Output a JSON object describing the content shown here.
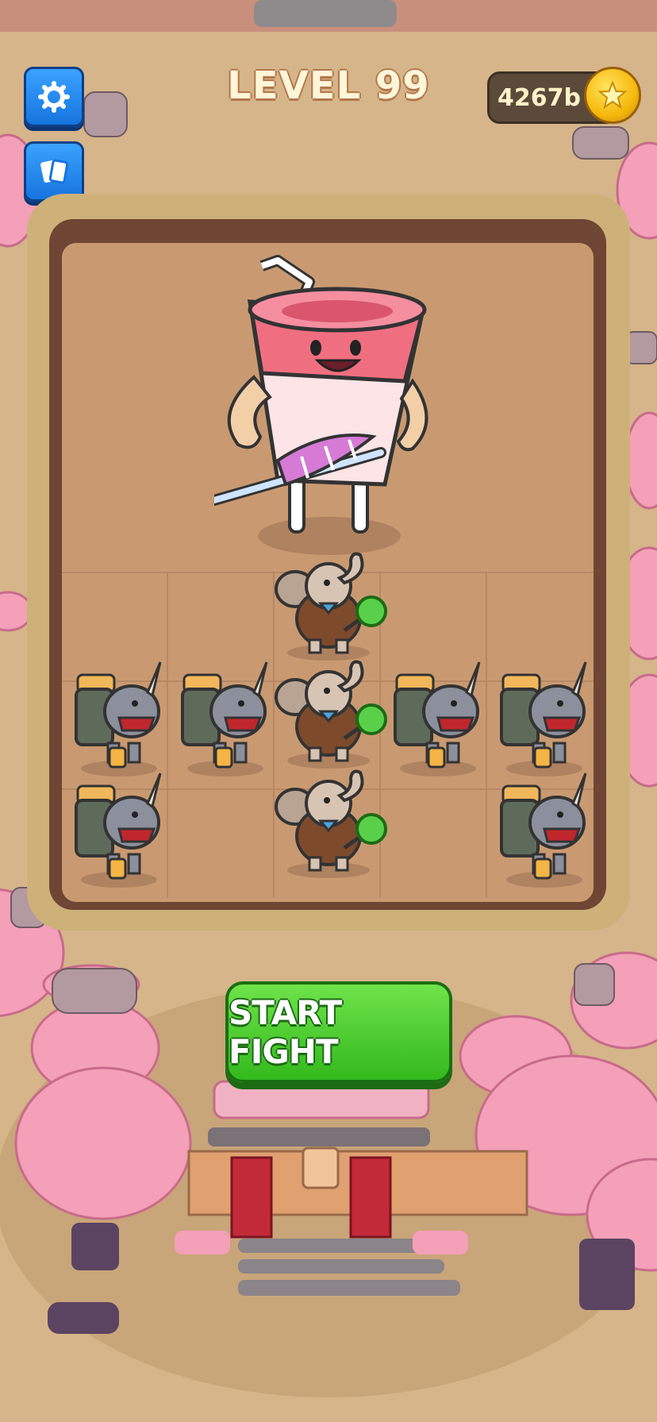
{
  "header": {
    "level_label": "LEVEL 99",
    "coins": "4267b"
  },
  "buttons": {
    "settings_icon": "gear-icon",
    "cards_icon": "cards-icon",
    "start_fight": "START FIGHT"
  },
  "board": {
    "boss": "milkshake-cup-boss",
    "units": [
      {
        "type": "elephant",
        "col": 3,
        "row": 1
      },
      {
        "type": "rhino",
        "col": 1,
        "row": 2
      },
      {
        "type": "rhino",
        "col": 2,
        "row": 2
      },
      {
        "type": "elephant",
        "col": 3,
        "row": 2
      },
      {
        "type": "rhino",
        "col": 4,
        "row": 2
      },
      {
        "type": "rhino",
        "col": 5,
        "row": 2
      },
      {
        "type": "rhino",
        "col": 1,
        "row": 3
      },
      {
        "type": "elephant",
        "col": 3,
        "row": 3
      },
      {
        "type": "rhino",
        "col": 5,
        "row": 3
      }
    ]
  },
  "colors": {
    "primary_button": "#33b91d",
    "icon_button": "#1674de",
    "board_frame": "#6f4534",
    "board_floor": "#c99a71"
  }
}
